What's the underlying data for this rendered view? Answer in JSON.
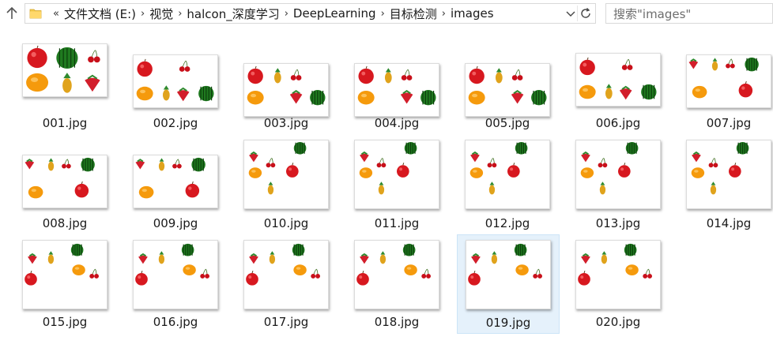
{
  "address": {
    "overflow": "«",
    "crumbs": [
      "文件文档 (E:)",
      "视觉",
      "halcon_深度学习",
      "DeepLearning",
      "目标检测",
      "images"
    ]
  },
  "search": {
    "placeholder": "搜索\"images\""
  },
  "icons": {
    "up": "up-arrow-icon",
    "folder": "folder-icon",
    "dropdown": "chevron-down-icon",
    "refresh": "refresh-icon",
    "fruit": [
      "apple",
      "watermelon",
      "cherry",
      "orange",
      "pineapple",
      "strawberry"
    ]
  },
  "files": [
    {
      "name": "001.jpg"
    },
    {
      "name": "002.jpg"
    },
    {
      "name": "003.jpg"
    },
    {
      "name": "004.jpg"
    },
    {
      "name": "005.jpg"
    },
    {
      "name": "006.jpg"
    },
    {
      "name": "007.jpg"
    },
    {
      "name": "008.jpg"
    },
    {
      "name": "009.jpg"
    },
    {
      "name": "010.jpg"
    },
    {
      "name": "011.jpg"
    },
    {
      "name": "012.jpg"
    },
    {
      "name": "013.jpg"
    },
    {
      "name": "014.jpg"
    },
    {
      "name": "015.jpg"
    },
    {
      "name": "016.jpg"
    },
    {
      "name": "017.jpg"
    },
    {
      "name": "018.jpg"
    },
    {
      "name": "019.jpg",
      "selected": true
    },
    {
      "name": "020.jpg"
    }
  ],
  "colors": {
    "selection_bg": "#e5f1fb",
    "selection_border": "#cce4f7"
  }
}
